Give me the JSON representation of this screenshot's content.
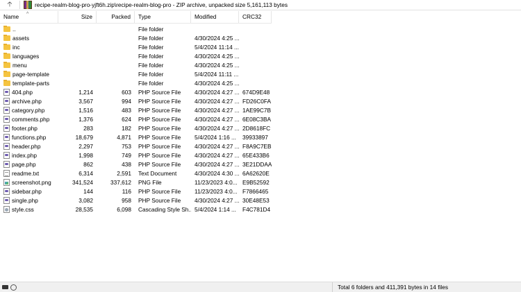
{
  "pathbar": {
    "up_icon": "up-arrow-icon",
    "archive_icon": "winrar-archive-icon",
    "path_text": "recipe-realm-blog-pro-yjft6h.zip\\recipe-realm-blog-pro - ZIP archive, unpacked size 5,161,113 bytes"
  },
  "columns": {
    "name": "Name",
    "size": "Size",
    "packed": "Packed",
    "type": "Type",
    "modified": "Modified",
    "crc": "CRC32"
  },
  "rows": [
    {
      "name": "..",
      "icon": "folder",
      "size": "",
      "packed": "",
      "type": "File folder",
      "modified": "",
      "crc": ""
    },
    {
      "name": "assets",
      "icon": "folder",
      "size": "",
      "packed": "",
      "type": "File folder",
      "modified": "4/30/2024 4:25 ...",
      "crc": ""
    },
    {
      "name": "inc",
      "icon": "folder",
      "size": "",
      "packed": "",
      "type": "File folder",
      "modified": "5/4/2024 11:14 ...",
      "crc": ""
    },
    {
      "name": "languages",
      "icon": "folder",
      "size": "",
      "packed": "",
      "type": "File folder",
      "modified": "4/30/2024 4:25 ...",
      "crc": ""
    },
    {
      "name": "menu",
      "icon": "folder",
      "size": "",
      "packed": "",
      "type": "File folder",
      "modified": "4/30/2024 4:25 ...",
      "crc": ""
    },
    {
      "name": "page-template",
      "icon": "folder",
      "size": "",
      "packed": "",
      "type": "File folder",
      "modified": "5/4/2024 11:11 ...",
      "crc": ""
    },
    {
      "name": "template-parts",
      "icon": "folder",
      "size": "",
      "packed": "",
      "type": "File folder",
      "modified": "4/30/2024 4:25 ...",
      "crc": ""
    },
    {
      "name": "404.php",
      "icon": "php",
      "size": "1,214",
      "packed": "603",
      "type": "PHP Source File",
      "modified": "4/30/2024 4:27 ...",
      "crc": "674D9E48"
    },
    {
      "name": "archive.php",
      "icon": "php",
      "size": "3,567",
      "packed": "994",
      "type": "PHP Source File",
      "modified": "4/30/2024 4:27 ...",
      "crc": "FD26C0FA"
    },
    {
      "name": "category.php",
      "icon": "php",
      "size": "1,516",
      "packed": "483",
      "type": "PHP Source File",
      "modified": "4/30/2024 4:27 ...",
      "crc": "1AE99C7B"
    },
    {
      "name": "comments.php",
      "icon": "php",
      "size": "1,376",
      "packed": "624",
      "type": "PHP Source File",
      "modified": "4/30/2024 4:27 ...",
      "crc": "6E08C3BA"
    },
    {
      "name": "footer.php",
      "icon": "php",
      "size": "283",
      "packed": "182",
      "type": "PHP Source File",
      "modified": "4/30/2024 4:27 ...",
      "crc": "2D8618FC"
    },
    {
      "name": "functions.php",
      "icon": "php",
      "size": "18,679",
      "packed": "4,871",
      "type": "PHP Source File",
      "modified": "5/4/2024 1:16 ...",
      "crc": "39933897"
    },
    {
      "name": "header.php",
      "icon": "php",
      "size": "2,297",
      "packed": "753",
      "type": "PHP Source File",
      "modified": "4/30/2024 4:27 ...",
      "crc": "F8A9C7EB"
    },
    {
      "name": "index.php",
      "icon": "php",
      "size": "1,998",
      "packed": "749",
      "type": "PHP Source File",
      "modified": "4/30/2024 4:27 ...",
      "crc": "65E433B6"
    },
    {
      "name": "page.php",
      "icon": "php",
      "size": "862",
      "packed": "438",
      "type": "PHP Source File",
      "modified": "4/30/2024 4:27 ...",
      "crc": "3E21DDAA"
    },
    {
      "name": "readme.txt",
      "icon": "doc",
      "size": "6,314",
      "packed": "2,591",
      "type": "Text Document",
      "modified": "4/30/2024 4:30 ...",
      "crc": "6A62620E"
    },
    {
      "name": "screenshot.png",
      "icon": "png",
      "size": "341,524",
      "packed": "337,612",
      "type": "PNG File",
      "modified": "11/23/2023 4:0...",
      "crc": "E9B52592"
    },
    {
      "name": "sidebar.php",
      "icon": "php",
      "size": "144",
      "packed": "116",
      "type": "PHP Source File",
      "modified": "11/23/2023 4:0...",
      "crc": "F7866465"
    },
    {
      "name": "single.php",
      "icon": "php",
      "size": "3,082",
      "packed": "958",
      "type": "PHP Source File",
      "modified": "4/30/2024 4:27 ...",
      "crc": "30E48E53"
    },
    {
      "name": "style.css",
      "icon": "css",
      "size": "28,535",
      "packed": "6,098",
      "type": "Cascading Style Sh...",
      "modified": "5/4/2024 1:14 ...",
      "crc": "F4C781D4"
    }
  ],
  "status": {
    "left_icons": [
      "drive-icon",
      "key-icon"
    ],
    "total_text": "Total 6 folders and 411,391 bytes in 14 files"
  }
}
